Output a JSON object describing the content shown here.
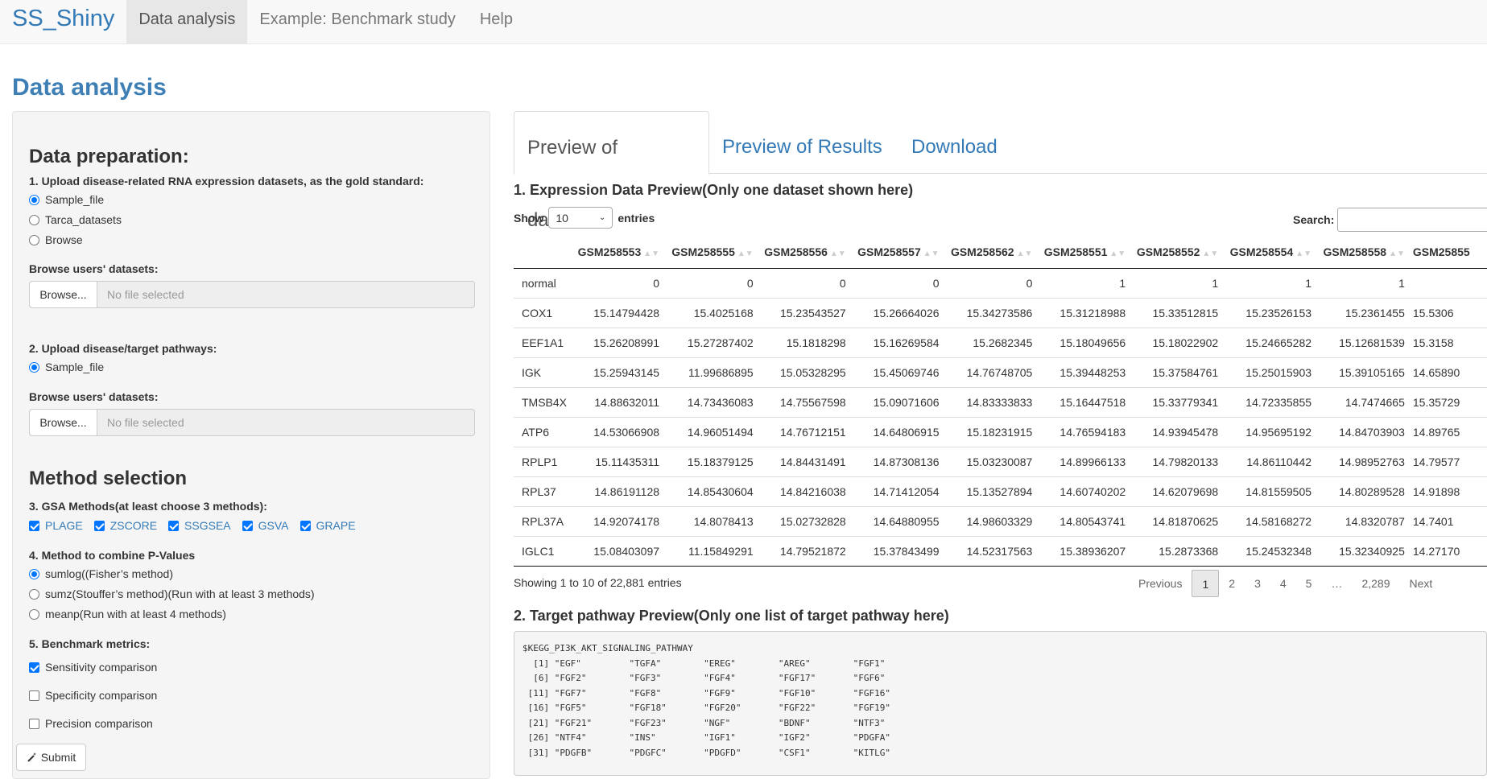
{
  "navbar": {
    "brand": "SS_Shiny",
    "tabs": [
      "Data analysis",
      "Example: Benchmark study",
      "Help"
    ]
  },
  "page_title": "Data analysis",
  "sidebar": {
    "data_prep_title": "Data preparation:",
    "q1_label": "1. Upload disease-related RNA expression datasets, as the gold standard:",
    "q1_options": [
      "Sample_file",
      "Tarca_datasets",
      "Browse"
    ],
    "browse_label_1": "Browse users' datasets:",
    "browse_btn": "Browse...",
    "no_file": "No file selected",
    "q2_label": "2. Upload disease/target pathways:",
    "q2_options": [
      "Sample_file"
    ],
    "browse_label_2": "Browse users' datasets:",
    "method_title": "Method selection",
    "q3_label": "3. GSA Methods(at least choose 3 methods):",
    "gsa_methods": [
      "PLAGE",
      "ZSCORE",
      "SSGSEA",
      "GSVA",
      "GRAPE"
    ],
    "q4_label": "4. Method to combine P-Values",
    "combine_options": [
      "sumlog((Fisher’s method)",
      "sumz(Stouffer’s method)(Run with at least 3 methods)",
      "meanp(Run with at least 4 methods)"
    ],
    "q5_label": "5. Benchmark metrics:",
    "metrics": [
      "Sensitivity comparison",
      "Specificity comparison",
      "Precision comparison"
    ],
    "submit": "Submit"
  },
  "main": {
    "tabs": [
      "Preview of datasets",
      "Preview of Results",
      "Download"
    ],
    "section1_title": "1. Expression Data Preview(Only one dataset shown here)",
    "show": "Show",
    "entries_value": "10",
    "entries": "entries",
    "search_label": "Search:",
    "columns": [
      "",
      "GSM258553",
      "GSM258555",
      "GSM258556",
      "GSM258557",
      "GSM258562",
      "GSM258551",
      "GSM258552",
      "GSM258554",
      "GSM258558",
      "GSM25855"
    ],
    "rows": [
      [
        "normal",
        "0",
        "0",
        "0",
        "0",
        "0",
        "1",
        "1",
        "1",
        "1",
        ""
      ],
      [
        "COX1",
        "15.14794428",
        "15.4025168",
        "15.23543527",
        "15.26664026",
        "15.34273586",
        "15.31218988",
        "15.33512815",
        "15.23526153",
        "15.2361455",
        "15.5306"
      ],
      [
        "EEF1A1",
        "15.26208991",
        "15.27287402",
        "15.1818298",
        "15.16269584",
        "15.2682345",
        "15.18049656",
        "15.18022902",
        "15.24665282",
        "15.12681539",
        "15.3158"
      ],
      [
        "IGK",
        "15.25943145",
        "11.99686895",
        "15.05328295",
        "15.45069746",
        "14.76748705",
        "15.39448253",
        "15.37584761",
        "15.25015903",
        "15.39105165",
        "14.65890"
      ],
      [
        "TMSB4X",
        "14.88632011",
        "14.73436083",
        "14.75567598",
        "15.09071606",
        "14.83333833",
        "15.16447518",
        "15.33779341",
        "14.72335855",
        "14.7474665",
        "15.35729"
      ],
      [
        "ATP6",
        "14.53066908",
        "14.96051494",
        "14.76712151",
        "14.64806915",
        "15.18231915",
        "14.76594183",
        "14.93945478",
        "14.95695192",
        "14.84703903",
        "14.89765"
      ],
      [
        "RPLP1",
        "15.11435311",
        "15.18379125",
        "14.84431491",
        "14.87308136",
        "15.03230087",
        "14.89966133",
        "14.79820133",
        "14.86110442",
        "14.98952763",
        "14.79577"
      ],
      [
        "RPL37",
        "14.86191128",
        "14.85430604",
        "14.84216038",
        "14.71412054",
        "15.13527894",
        "14.60740202",
        "14.62079698",
        "14.81559505",
        "14.80289528",
        "14.91898"
      ],
      [
        "RPL37A",
        "14.92074178",
        "14.8078413",
        "15.02732828",
        "14.64880955",
        "14.98603329",
        "14.80543741",
        "14.81870625",
        "14.58168272",
        "14.8320787",
        "14.7401"
      ],
      [
        "IGLC1",
        "15.08403097",
        "11.15849291",
        "14.79521872",
        "15.37843499",
        "14.52317563",
        "15.38936207",
        "15.2873368",
        "15.24532348",
        "15.32340925",
        "14.27170"
      ]
    ],
    "info": "Showing 1 to 10 of 22,881 entries",
    "pager": [
      "Previous",
      "1",
      "2",
      "3",
      "4",
      "5",
      "…",
      "2,289",
      "Next"
    ],
    "section2_title": "2. Target pathway Preview(Only one list of target pathway here)",
    "pathway_text": "$KEGG_PI3K_AKT_SIGNALING_PATHWAY\n  [1] \"EGF\"         \"TGFA\"        \"EREG\"        \"AREG\"        \"FGF1\"\n  [6] \"FGF2\"        \"FGF3\"        \"FGF4\"        \"FGF17\"       \"FGF6\"\n [11] \"FGF7\"        \"FGF8\"        \"FGF9\"        \"FGF10\"       \"FGF16\"\n [16] \"FGF5\"        \"FGF18\"       \"FGF20\"       \"FGF22\"       \"FGF19\"\n [21] \"FGF21\"       \"FGF23\"       \"NGF\"         \"BDNF\"        \"NTF3\"\n [26] \"NTF4\"        \"INS\"         \"IGF1\"        \"IGF2\"        \"PDGFA\"\n [31] \"PDGFB\"       \"PDGFC\"       \"PDGFD\"       \"CSF1\"        \"KITLG\""
  }
}
